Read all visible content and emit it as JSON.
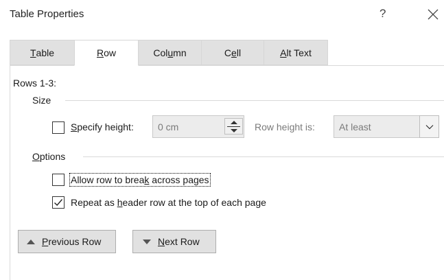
{
  "dialog": {
    "title": "Table Properties",
    "help_label": "?",
    "close_icon": "close-icon"
  },
  "tabs": [
    {
      "label": "Table",
      "mnemonic": "T",
      "rest": "able"
    },
    {
      "label": "Row",
      "mnemonic": "R",
      "rest": "ow"
    },
    {
      "label": "Column",
      "pre": "Col",
      "mnemonic": "u",
      "rest": "mn"
    },
    {
      "label": "Cell",
      "pre": "C",
      "mnemonic": "e",
      "rest": "ll"
    },
    {
      "label": "Alt Text",
      "mnemonic": "A",
      "rest": "lt Text"
    }
  ],
  "active_tab": "Row",
  "row_panel": {
    "rows_label": "Rows 1-3:",
    "size_group": {
      "title": "Size",
      "specify_height": {
        "mnemonic": "S",
        "rest": "pecify height:",
        "checked": false
      },
      "height_value": "0 cm",
      "row_height_is_label": "Row height is:",
      "row_height_is_value": "At least"
    },
    "options_group": {
      "title_mnemonic": "O",
      "title_rest": "ptions",
      "allow_break": {
        "pre": "Allow row to brea",
        "mnemonic": "k",
        "rest": " across pages",
        "checked": false
      },
      "repeat_header": {
        "pre": "Repeat as ",
        "mnemonic": "h",
        "rest": "eader row at the top of each page",
        "checked": true
      }
    }
  },
  "nav_buttons": {
    "previous": {
      "mnemonic": "P",
      "rest": "revious Row"
    },
    "next": {
      "mnemonic": "N",
      "rest": "ext Row"
    }
  }
}
